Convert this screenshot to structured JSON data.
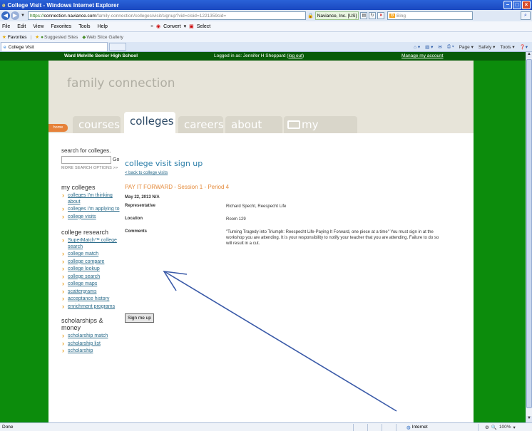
{
  "window": {
    "title": "College Visit - Windows Internet Explorer",
    "icon": "ie-icon"
  },
  "address": {
    "url_proto": "https://",
    "url_domain": "connection.naviance.com",
    "url_rest": "/family-connection/colleges/visit/signup?vid=cloid=1221359cid=",
    "secure_identity": "Naviance, Inc. [US]",
    "search_placeholder": "Bing"
  },
  "menu": {
    "items": [
      "File",
      "Edit",
      "View",
      "Favorites",
      "Tools",
      "Help"
    ],
    "convert_label": "Convert",
    "select_label": "Select"
  },
  "favorites": {
    "label": "Favorites",
    "suggested_sites": "Suggested Sites",
    "web_slice": "Web Slice Gallery"
  },
  "tab": {
    "title": "College Visit"
  },
  "command_bar": {
    "page": "Page",
    "safety": "Safety",
    "tools": "Tools"
  },
  "site_header": {
    "school": "Ward Melville Senior High School",
    "logged_in_prefix": "Logged in as: Jennifer H Sheppard (",
    "logout": "log out",
    "logged_in_suffix": ")",
    "manage_account": "Manage my account"
  },
  "brand": {
    "title": "family connection"
  },
  "nav": {
    "home": "home",
    "tabs": [
      "courses",
      "colleges",
      "careers",
      "about me",
      "my planner"
    ],
    "active": "colleges"
  },
  "sidebar": {
    "search_heading": "search for colleges.",
    "go": "Go",
    "more_options": "MORE SEARCH OPTIONS >>",
    "my_colleges_heading": "my colleges",
    "my_colleges": [
      "colleges I'm thinking about",
      "colleges I'm applying to",
      "college visits"
    ],
    "research_heading": "college research",
    "research": [
      "SuperMatch™ college search",
      "college match",
      "college compare",
      "college lookup",
      "college search",
      "college maps",
      "scattergrams",
      "acceptance history",
      "enrichment programs"
    ],
    "scholarships_heading": "scholarships & money",
    "scholarships": [
      "scholarship match",
      "scholarship list",
      "scholarship"
    ]
  },
  "main": {
    "heading": "college visit sign up",
    "back_link": "< back to college visits",
    "event_title": "PAY IT FORWARD - Session 1 - Period 4",
    "date": "May 22, 2013 N/A",
    "rows": [
      {
        "label": "Representative",
        "value": "Richard Specht, Reespecht Life"
      },
      {
        "label": "Location",
        "value": "Room 129"
      },
      {
        "label": "Comments",
        "value": "\"Turning Tragedy into Triumph: Reespecht Life-Paying It Forward, one piece at a time\" You must sign in at the workshop you are attending. It is your responsibility to notify your teacher that you are attending. Failure to do so will result in a cut."
      }
    ],
    "signup_button": "Sign me up"
  },
  "status": {
    "left": "Done",
    "zone": "Internet",
    "zoom": "100%"
  },
  "colors": {
    "site_green": "#0c8c0c",
    "header_green": "#085c08",
    "brand_beige": "#e7e4d9",
    "accent_orange": "#e48a3a",
    "heading_blue": "#2a7da8",
    "arrow_blue": "#3a5aa8"
  }
}
